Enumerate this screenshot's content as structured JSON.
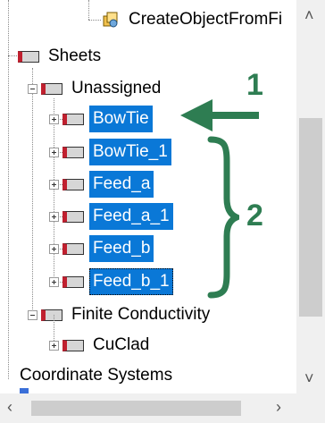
{
  "tree": {
    "top_item": "CreateObjectFromFi",
    "sheets": "Sheets",
    "unassigned": "Unassigned",
    "items": [
      "BowTie",
      "BowTie_1",
      "Feed_a",
      "Feed_a_1",
      "Feed_b",
      "Feed_b_1"
    ],
    "finite_conductivity": "Finite Conductivity",
    "cuclad": "CuClad",
    "coordinate_systems": "Coordinate Systems"
  },
  "annotations": {
    "label_1": "1",
    "label_2": "2",
    "color": "#2e7d52"
  },
  "colors": {
    "selection": "#0a78d7",
    "sheet_accent": "#c0202f"
  },
  "icons": {
    "top_item": "script-object-icon",
    "sheet": "sheet-icon",
    "scroll_up": "chevron-up-icon",
    "scroll_down": "chevron-down-icon",
    "scroll_left": "chevron-left-icon",
    "scroll_right": "chevron-right-icon"
  }
}
